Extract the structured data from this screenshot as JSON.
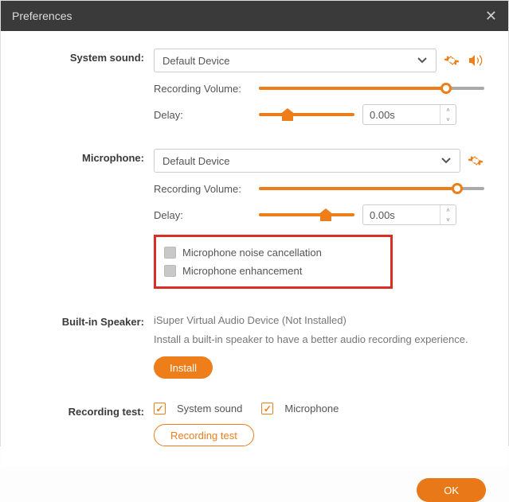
{
  "window": {
    "title": "Preferences"
  },
  "systemSound": {
    "label": "System sound:",
    "device": "Default Device",
    "recVolLabel": "Recording Volume:",
    "recVolPercent": 83,
    "delayLabel": "Delay:",
    "delayPercent": 30,
    "delayValue": "0.00s"
  },
  "microphone": {
    "label": "Microphone:",
    "device": "Default Device",
    "recVolLabel": "Recording Volume:",
    "recVolPercent": 88,
    "delayLabel": "Delay:",
    "delayPercent": 70,
    "delayValue": "0.00s",
    "noiseCancelLabel": "Microphone noise cancellation",
    "enhanceLabel": "Microphone enhancement"
  },
  "speaker": {
    "label": "Built-in Speaker:",
    "status": "iSuper Virtual Audio Device (Not Installed)",
    "info": "Install a built-in speaker to have a better audio recording experience.",
    "installBtn": "Install"
  },
  "test": {
    "label": "Recording test:",
    "sysLabel": "System sound",
    "micLabel": "Microphone",
    "btn": "Recording test"
  },
  "footer": {
    "ok": "OK"
  }
}
